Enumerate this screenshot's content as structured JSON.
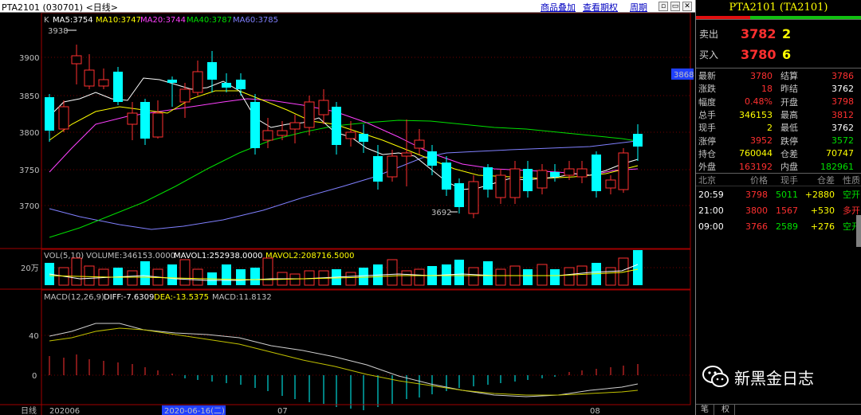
{
  "topbar": {
    "symbol_title": "PTA2101 (030701) <日线>",
    "links": [
      "商品叠加",
      "查看期权",
      "周期"
    ],
    "window_buttons": [
      "restore-icon",
      "minimize-icon",
      "close-icon"
    ]
  },
  "price_panel": {
    "ma_prefix": "K",
    "ma": [
      {
        "label": "MA5:3754",
        "color": "#ffffff"
      },
      {
        "label": "MA10:3747",
        "color": "#ffff00"
      },
      {
        "label": "MA20:3744",
        "color": "#ff40ff"
      },
      {
        "label": "MA40:3787",
        "color": "#00e000"
      },
      {
        "label": "MA60:3785",
        "color": "#8080ff"
      }
    ],
    "y_ticks": [
      "3900",
      "3850",
      "3800",
      "3750",
      "3700"
    ],
    "high_marker": "3938",
    "low_marker": "3692",
    "last_price_tag": "3868"
  },
  "volume_panel": {
    "label": "VOL(5,10)",
    "volume": "VOLUME:346153.0000",
    "mavol1": "MAVOL1:252938.0000",
    "mavol2": "MAVOL2:208716.5000",
    "y_tick": "20万"
  },
  "macd_panel": {
    "label": "MACD(12,26,9)",
    "diff": "DIFF:-7.6309",
    "dea": "DEA:-13.5375",
    "macd": "MACD:11.8132",
    "y_ticks": [
      "40",
      "0"
    ]
  },
  "x_axis": {
    "period": "日线",
    "labels": [
      "202006",
      "2020-06-16(二)",
      "07",
      "08"
    ]
  },
  "right_panel": {
    "title": "PTA2101 (TA2101)",
    "sell": {
      "label": "卖出",
      "price": "3782",
      "qty": "2"
    },
    "buy": {
      "label": "买入",
      "price": "3780",
      "qty": "6"
    },
    "stats": [
      {
        "k1": "最新",
        "v1": "3780",
        "c1": "#ff3030",
        "k2": "结算",
        "v2": "3786",
        "c2": "#ff3030"
      },
      {
        "k1": "涨跌",
        "v1": "18",
        "c1": "#ff3030",
        "k2": "昨结",
        "v2": "3762",
        "c2": "#ffffff"
      },
      {
        "k1": "幅度",
        "v1": "0.48%",
        "c1": "#ff3030",
        "k2": "开盘",
        "v2": "3798",
        "c2": "#ff3030"
      },
      {
        "k1": "总手",
        "v1": "346153",
        "c1": "#ffff00",
        "k2": "最高",
        "v2": "3812",
        "c2": "#ff3030"
      },
      {
        "k1": "现手",
        "v1": "2",
        "c1": "#ffff00",
        "k2": "最低",
        "v2": "3762",
        "c2": "#ffffff"
      },
      {
        "k1": "涨停",
        "v1": "3952",
        "c1": "#ff3030",
        "k2": "跌停",
        "v2": "3572",
        "c2": "#00e000"
      },
      {
        "k1": "持仓",
        "v1": "760044",
        "c1": "#ffff00",
        "k2": "仓差",
        "v2": "70747",
        "c2": "#ffff00"
      },
      {
        "k1": "外盘",
        "v1": "163192",
        "c1": "#ff3030",
        "k2": "内盘",
        "v2": "182961",
        "c2": "#00e000"
      }
    ],
    "ticks_header": [
      "北京",
      "价格",
      "现手",
      "仓差",
      "性质"
    ],
    "ticks": [
      {
        "time": "20:59",
        "price": "3798",
        "price_color": "#ff3030",
        "qty": "5011",
        "qty_color": "#00e000",
        "oi": "+2880",
        "nature": "空开",
        "nature_color": "#00e000"
      },
      {
        "time": "21:00",
        "price": "3800",
        "price_color": "#ff3030",
        "qty": "1567",
        "qty_color": "#ff3030",
        "oi": "+530",
        "nature": "多开",
        "nature_color": "#ff3030"
      },
      {
        "time": "09:00",
        "price": "3766",
        "price_color": "#ff3030",
        "qty": "2589",
        "qty_color": "#00e000",
        "oi": "+276",
        "nature": "空开",
        "nature_color": "#00e000"
      }
    ],
    "watermark": "新黑金日志",
    "bottom_tabs": [
      "笔",
      "权"
    ]
  },
  "colors": {
    "up": "#ff3030",
    "down": "#00ffff",
    "grid": "#800000"
  }
}
